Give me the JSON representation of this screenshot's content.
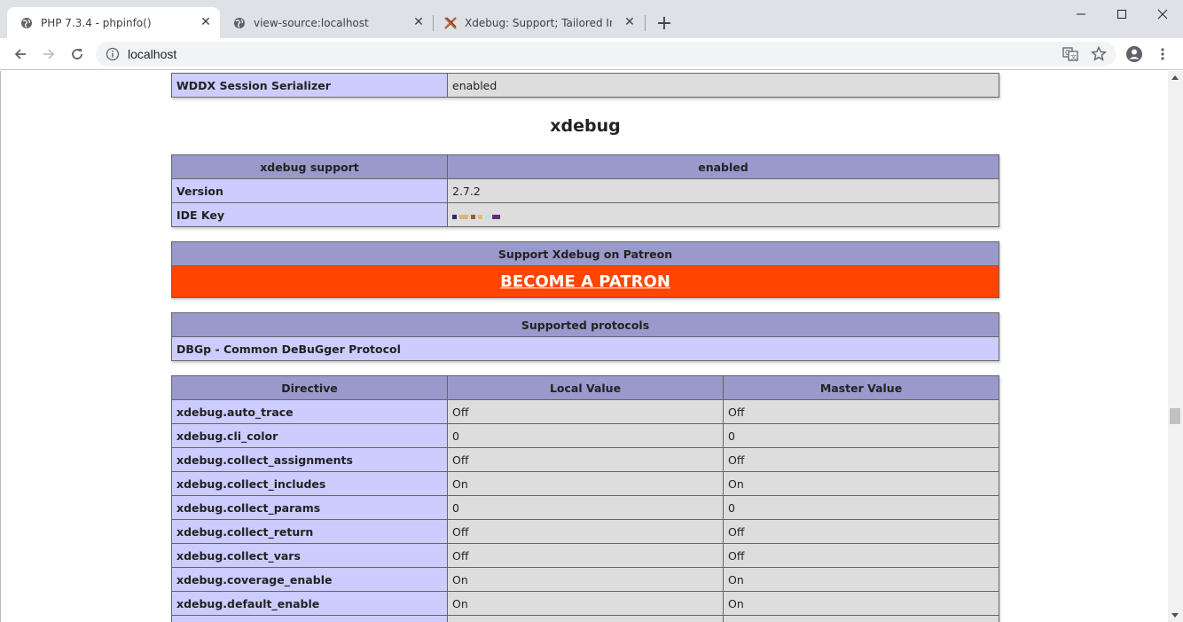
{
  "browser": {
    "tabs": [
      {
        "title": "PHP 7.3.4 - phpinfo()",
        "icon": "globe-icon",
        "active": true
      },
      {
        "title": "view-source:localhost",
        "icon": "globe-icon",
        "active": false
      },
      {
        "title": "Xdebug: Support; Tailored Installa",
        "icon": "xdebug-icon",
        "active": false
      }
    ],
    "url": "localhost"
  },
  "wddx": {
    "label": "WDDX Session Serializer",
    "value": "enabled"
  },
  "xdebug": {
    "heading": "xdebug",
    "support_header": [
      "xdebug support",
      "enabled"
    ],
    "info_rows": [
      {
        "label": "Version",
        "value": "2.7.2"
      },
      {
        "label": "IDE Key",
        "value": ""
      }
    ],
    "ide_key_colors": [
      "#2b2b6b",
      "#ddb27a",
      "#d9a066",
      "#a05a2c",
      "#e6b87a",
      "#bfe0e8",
      "#5c2f7a"
    ],
    "patreon": {
      "header": "Support Xdebug on Patreon",
      "link": "BECOME A PATRON",
      "color": "#ff4500"
    },
    "protocols": {
      "header": "Supported protocols",
      "value": "DBGp - Common DeBuGger Protocol"
    },
    "directives": {
      "headers": [
        "Directive",
        "Local Value",
        "Master Value"
      ],
      "rows": [
        {
          "name": "xdebug.auto_trace",
          "local": "Off",
          "master": "Off"
        },
        {
          "name": "xdebug.cli_color",
          "local": "0",
          "master": "0"
        },
        {
          "name": "xdebug.collect_assignments",
          "local": "Off",
          "master": "Off"
        },
        {
          "name": "xdebug.collect_includes",
          "local": "On",
          "master": "On"
        },
        {
          "name": "xdebug.collect_params",
          "local": "0",
          "master": "0"
        },
        {
          "name": "xdebug.collect_return",
          "local": "Off",
          "master": "Off"
        },
        {
          "name": "xdebug.collect_vars",
          "local": "Off",
          "master": "Off"
        },
        {
          "name": "xdebug.coverage_enable",
          "local": "On",
          "master": "On"
        },
        {
          "name": "xdebug.default_enable",
          "local": "On",
          "master": "On"
        }
      ]
    }
  },
  "colors": {
    "header_bg": "#9999cc",
    "label_bg": "#ccccff",
    "value_bg": "#dddddd"
  }
}
